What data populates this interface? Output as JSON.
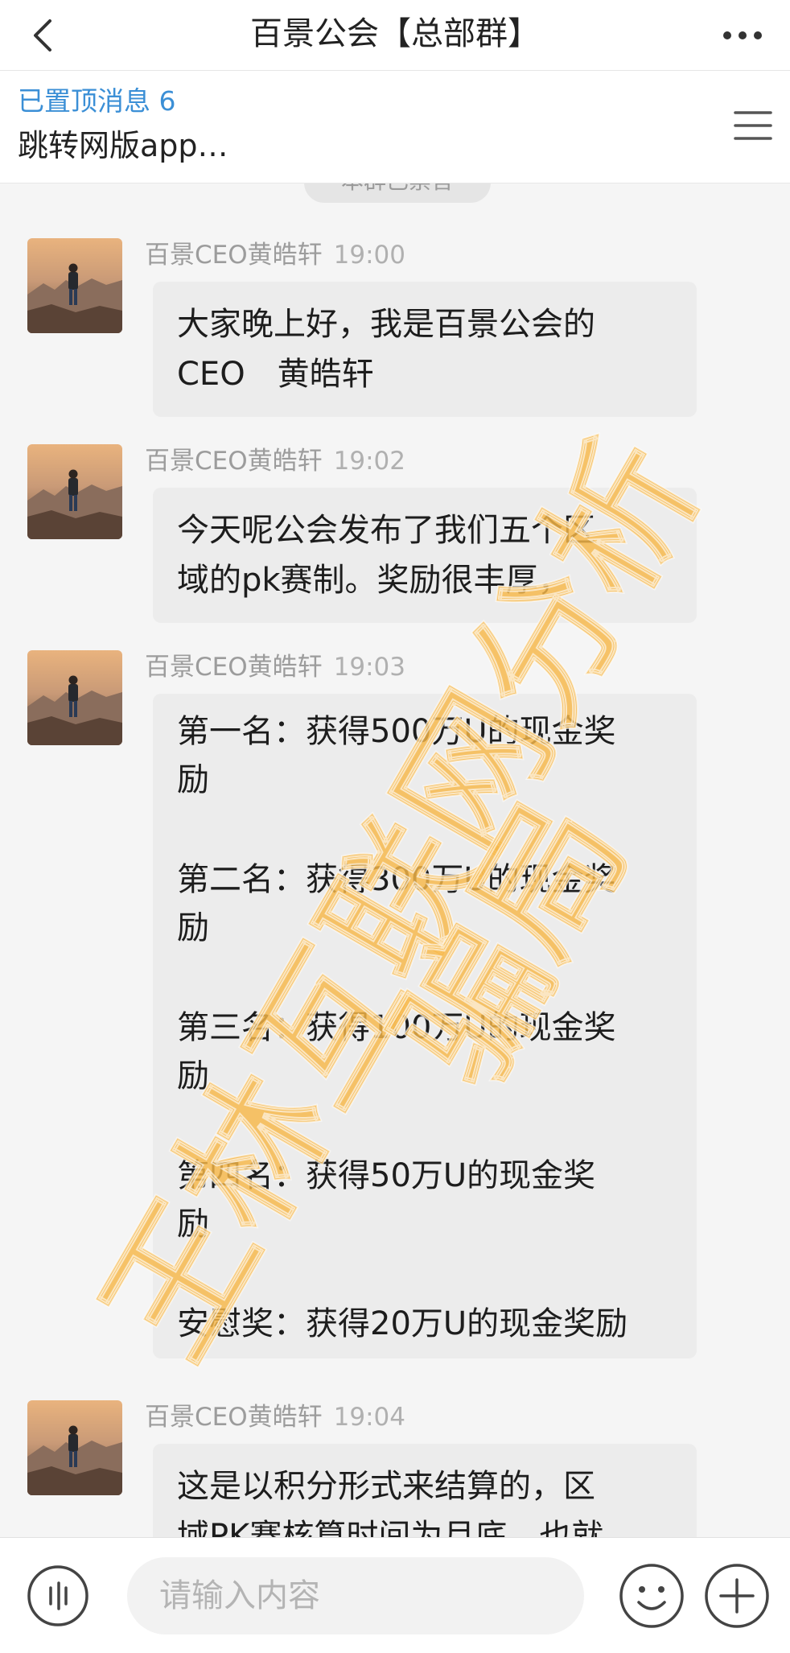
{
  "header": {
    "title": "百景公会【总部群】"
  },
  "pinned": {
    "label": "已置顶消息 6",
    "preview": "跳转网版app…"
  },
  "system_notice": "本群已禁言",
  "messages": [
    {
      "sender": "百景CEO黄皓轩",
      "time": "19:00",
      "lines": [
        "大家晚上好，我是百景公会的",
        "CEO　黄皓轩"
      ]
    },
    {
      "sender": "百景CEO黄皓轩",
      "time": "19:02",
      "lines": [
        "今天呢公会发布了我们五个区",
        "域的pk赛制。奖励很丰厚，"
      ]
    },
    {
      "sender": "百景CEO黄皓轩",
      "time": "19:03",
      "lines": [
        "第一名：获得500万U的现金奖",
        "励",
        "",
        "第二名：获得300万U的现金奖",
        "励",
        "",
        "第三名：获得100万U的现金奖",
        "励",
        "",
        "第四名：获得50万U的现金奖",
        "励",
        "",
        "安慰奖：获得20万U的现金奖励"
      ]
    },
    {
      "sender": "百景CEO黄皓轩",
      "time": "19:04",
      "lines": [
        "这是以积分形式来结算的，区",
        "域PK赛核算时间为月底，也就"
      ]
    }
  ],
  "watermark": {
    "line1": "王林互联网分析",
    "line2": "骗局",
    "color": "#f7b748"
  },
  "input": {
    "placeholder": "请输入内容"
  },
  "icons": [
    "back-arrow-icon",
    "more-icon",
    "menu-icon",
    "voice-icon",
    "emoji-icon",
    "plus-icon"
  ]
}
